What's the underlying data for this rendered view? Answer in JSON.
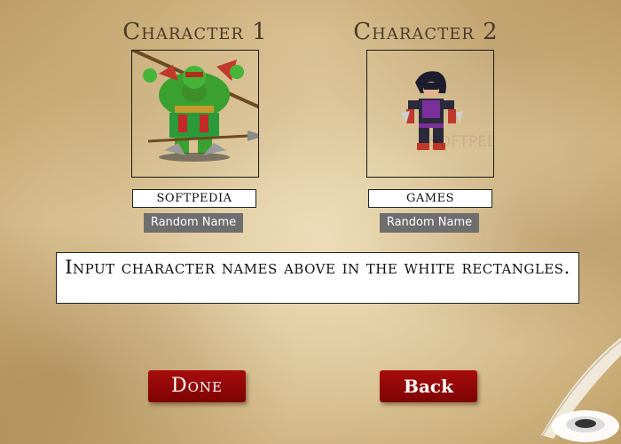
{
  "characters": [
    {
      "heading": "Character 1",
      "name_value": "SOFTPEDIA",
      "random_label": "Random Name",
      "portrait": "orc-warrior-sprite"
    },
    {
      "heading": "Character 2",
      "name_value": "GAMES",
      "random_label": "Random Name",
      "portrait": "ninja-fighter-sprite"
    }
  ],
  "instruction": "Input character names above in the white rectangles.",
  "buttons": {
    "done": "Done",
    "back": "Back"
  },
  "watermark": "SOFTPEDIA",
  "colors": {
    "button_red": "#9a0808",
    "parchment": "#e0cb9f",
    "random_btn": "#6e6e6e"
  }
}
